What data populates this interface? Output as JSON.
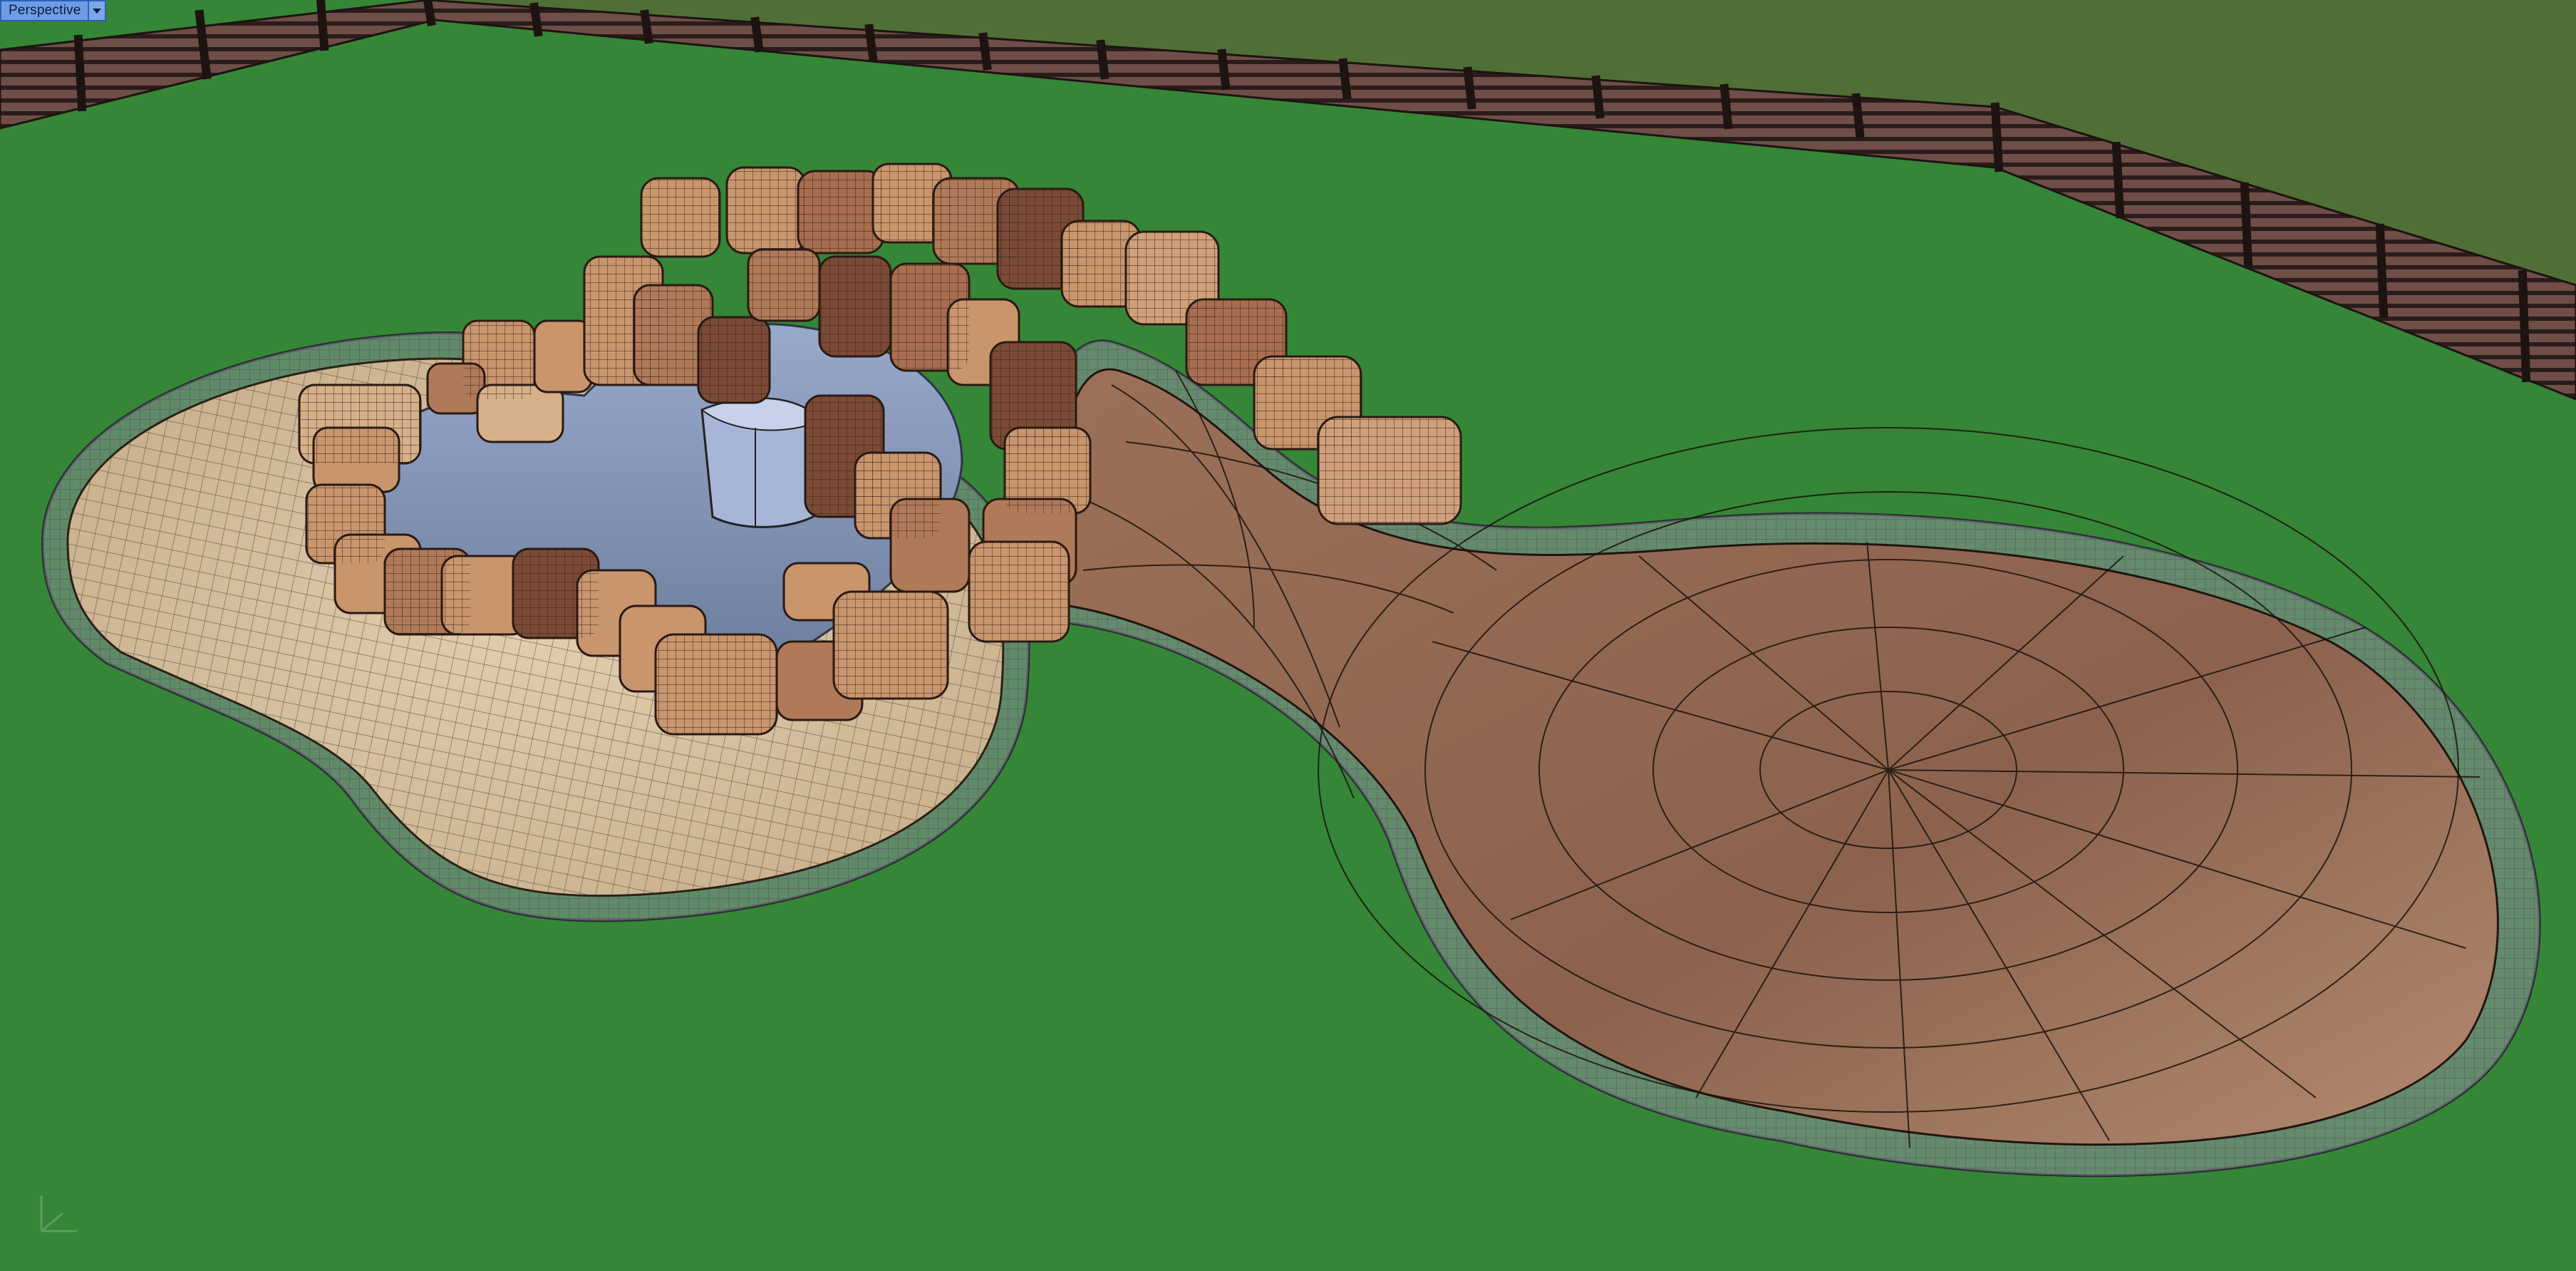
{
  "viewport": {
    "title": "Perspective",
    "menu_icon": "chevron-down-icon"
  },
  "scene": {
    "background_top": "#4f6f36",
    "ground_color": "#358637",
    "fence_color": "#6b4a45",
    "fence_dark": "#2a1c1a",
    "pond_water": "#7c8db0",
    "pond_deck": "#d8c2a2",
    "patio_surface": "#8e6651",
    "border_stone": "#8b8f98",
    "rock_color": "#c8956d",
    "rock_dark": "#7b4a36",
    "tub_color": "#a7b5d8"
  },
  "axis_icon": "world-axes-icon"
}
